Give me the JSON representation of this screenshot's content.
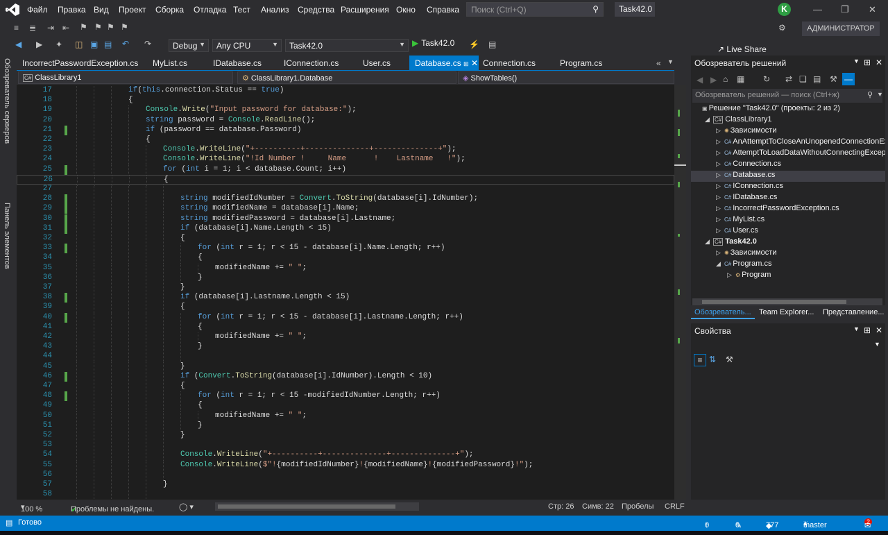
{
  "menu": {
    "items": [
      "Файл",
      "Правка",
      "Вид",
      "Проект",
      "Сборка",
      "Отладка",
      "Тест",
      "Анализ",
      "Средства",
      "Расширения",
      "Окно",
      "Справка"
    ],
    "search_placeholder": "Поиск (Ctrl+Q)",
    "solution_title": "Task42.0",
    "avatar_letter": "K"
  },
  "toolbar": {
    "config": "Debug",
    "platform": "Any CPU",
    "startup_project": "Task42.0",
    "run_label": "Task42.0",
    "live_share": "Live Share",
    "admin_label": "АДМИНИСТРАТОР"
  },
  "side_tabs": [
    "Обозреватель серверов",
    "Панель элементов"
  ],
  "doc_tabs": [
    {
      "label": "IncorrectPasswordException.cs"
    },
    {
      "label": "MyList.cs"
    },
    {
      "label": "IDatabase.cs"
    },
    {
      "label": "IConnection.cs"
    },
    {
      "label": "User.cs"
    },
    {
      "label": "Database.cs",
      "active": true
    },
    {
      "label": "Connection.cs"
    },
    {
      "label": "Program.cs"
    }
  ],
  "nav": {
    "project": "ClassLibrary1",
    "type": "ClassLibrary1.Database",
    "member": "ShowTables()"
  },
  "code_lines": [
    {
      "n": "17",
      "indent": 3,
      "changed": false,
      "t": [
        [
          "kw",
          "if"
        ],
        [
          "",
          "("
        ],
        [
          "kw",
          "this"
        ],
        [
          "",
          ".connection.Status == "
        ],
        [
          "kw",
          "true"
        ],
        [
          "",
          ")"
        ]
      ]
    },
    {
      "n": "18",
      "indent": 3,
      "changed": false,
      "t": [
        [
          "",
          "{"
        ]
      ]
    },
    {
      "n": "19",
      "indent": 4,
      "changed": false,
      "t": [
        [
          "ty",
          "Console"
        ],
        [
          "",
          "."
        ],
        [
          "me",
          "Write"
        ],
        [
          "",
          "("
        ],
        [
          "st",
          "\"Input password for database:\""
        ],
        [
          "",
          ");"
        ]
      ]
    },
    {
      "n": "20",
      "indent": 4,
      "changed": false,
      "t": [
        [
          "kw",
          "string"
        ],
        [
          "",
          " password = "
        ],
        [
          "ty",
          "Console"
        ],
        [
          "",
          "."
        ],
        [
          "me",
          "ReadLine"
        ],
        [
          "",
          "();"
        ]
      ]
    },
    {
      "n": "21",
      "indent": 4,
      "changed": true,
      "t": [
        [
          "kw",
          "if"
        ],
        [
          "",
          " (password == database.Password)"
        ]
      ]
    },
    {
      "n": "22",
      "indent": 4,
      "changed": false,
      "t": [
        [
          "",
          "{"
        ]
      ]
    },
    {
      "n": "23",
      "indent": 5,
      "changed": false,
      "t": [
        [
          "ty",
          "Console"
        ],
        [
          "",
          "."
        ],
        [
          "me",
          "WriteLine"
        ],
        [
          "",
          "("
        ],
        [
          "st",
          "\"+----------+--------------+--------------+\""
        ],
        [
          "",
          ");"
        ]
      ]
    },
    {
      "n": "24",
      "indent": 5,
      "changed": false,
      "t": [
        [
          "ty",
          "Console"
        ],
        [
          "",
          "."
        ],
        [
          "me",
          "WriteLine"
        ],
        [
          "",
          "("
        ],
        [
          "st",
          "\"!Id Number !     Name      !    Lastname   !\""
        ],
        [
          "",
          ");"
        ]
      ]
    },
    {
      "n": "25",
      "indent": 5,
      "changed": true,
      "t": [
        [
          "kw",
          "for"
        ],
        [
          "",
          " ("
        ],
        [
          "kw",
          "int"
        ],
        [
          "",
          " i = 1; i < database.Count; i++)"
        ]
      ]
    },
    {
      "n": "26",
      "indent": 5,
      "changed": false,
      "current": true,
      "t": [
        [
          "",
          "{"
        ]
      ]
    },
    {
      "n": "27",
      "indent": 6,
      "changed": false,
      "t": []
    },
    {
      "n": "28",
      "indent": 6,
      "changed": true,
      "t": [
        [
          "kw",
          "string"
        ],
        [
          "",
          " modifiedIdNumber = "
        ],
        [
          "ty",
          "Convert"
        ],
        [
          "",
          "."
        ],
        [
          "me",
          "ToString"
        ],
        [
          "",
          "(database[i].IdNumber);"
        ]
      ]
    },
    {
      "n": "29",
      "indent": 6,
      "changed": true,
      "t": [
        [
          "kw",
          "string"
        ],
        [
          "",
          " modifiedName = database[i].Name;"
        ]
      ]
    },
    {
      "n": "30",
      "indent": 6,
      "changed": true,
      "t": [
        [
          "kw",
          "string"
        ],
        [
          "",
          " modifiedPassword = database[i].Lastname;"
        ]
      ]
    },
    {
      "n": "31",
      "indent": 6,
      "changed": true,
      "t": [
        [
          "kw",
          "if"
        ],
        [
          "",
          " (database[i].Name.Length < 15)"
        ]
      ]
    },
    {
      "n": "32",
      "indent": 6,
      "changed": false,
      "t": [
        [
          "",
          "{"
        ]
      ]
    },
    {
      "n": "33",
      "indent": 7,
      "changed": true,
      "t": [
        [
          "kw",
          "for"
        ],
        [
          "",
          " ("
        ],
        [
          "kw",
          "int"
        ],
        [
          "",
          " r = 1; r < 15 - database[i].Name.Length; r++)"
        ]
      ]
    },
    {
      "n": "34",
      "indent": 7,
      "changed": false,
      "t": [
        [
          "",
          "{"
        ]
      ]
    },
    {
      "n": "35",
      "indent": 8,
      "changed": false,
      "t": [
        [
          "",
          "modifiedName += "
        ],
        [
          "st",
          "\" \""
        ],
        [
          "",
          ";"
        ]
      ]
    },
    {
      "n": "36",
      "indent": 7,
      "changed": false,
      "t": [
        [
          "",
          "}"
        ]
      ]
    },
    {
      "n": "37",
      "indent": 6,
      "changed": false,
      "t": [
        [
          "",
          "}"
        ]
      ]
    },
    {
      "n": "38",
      "indent": 6,
      "changed": true,
      "t": [
        [
          "kw",
          "if"
        ],
        [
          "",
          " (database[i].Lastname.Length < 15)"
        ]
      ]
    },
    {
      "n": "39",
      "indent": 6,
      "changed": false,
      "t": [
        [
          "",
          "{"
        ]
      ]
    },
    {
      "n": "40",
      "indent": 7,
      "changed": true,
      "t": [
        [
          "kw",
          "for"
        ],
        [
          "",
          " ("
        ],
        [
          "kw",
          "int"
        ],
        [
          "",
          " r = 1; r < 15 - database[i].Lastname.Length; r++)"
        ]
      ]
    },
    {
      "n": "41",
      "indent": 7,
      "changed": false,
      "t": [
        [
          "",
          "{"
        ]
      ]
    },
    {
      "n": "42",
      "indent": 8,
      "changed": false,
      "t": [
        [
          "",
          "modifiedName += "
        ],
        [
          "st",
          "\" \""
        ],
        [
          "",
          ";"
        ]
      ]
    },
    {
      "n": "43",
      "indent": 7,
      "changed": false,
      "t": [
        [
          "",
          "}"
        ]
      ]
    },
    {
      "n": "44",
      "indent": 7,
      "changed": false,
      "t": []
    },
    {
      "n": "45",
      "indent": 6,
      "changed": false,
      "t": [
        [
          "",
          "}"
        ]
      ]
    },
    {
      "n": "46",
      "indent": 6,
      "changed": true,
      "t": [
        [
          "kw",
          "if"
        ],
        [
          "",
          " ("
        ],
        [
          "ty",
          "Convert"
        ],
        [
          "",
          "."
        ],
        [
          "me",
          "ToString"
        ],
        [
          "",
          "(database[i].IdNumber).Length < 10)"
        ]
      ]
    },
    {
      "n": "47",
      "indent": 6,
      "changed": false,
      "t": [
        [
          "",
          "{"
        ]
      ]
    },
    {
      "n": "48",
      "indent": 7,
      "changed": true,
      "t": [
        [
          "kw",
          "for"
        ],
        [
          "",
          " ("
        ],
        [
          "kw",
          "int"
        ],
        [
          "",
          " r = 1; r < 15 -modifiedIdNumber.Length; r++)"
        ]
      ]
    },
    {
      "n": "49",
      "indent": 7,
      "changed": false,
      "t": [
        [
          "",
          "{"
        ]
      ]
    },
    {
      "n": "50",
      "indent": 8,
      "changed": false,
      "t": [
        [
          "",
          "modifiedName += "
        ],
        [
          "st",
          "\" \""
        ],
        [
          "",
          ";"
        ]
      ]
    },
    {
      "n": "51",
      "indent": 7,
      "changed": false,
      "t": [
        [
          "",
          "}"
        ]
      ]
    },
    {
      "n": "52",
      "indent": 6,
      "changed": false,
      "t": [
        [
          "",
          "}"
        ]
      ]
    },
    {
      "n": "53",
      "indent": 6,
      "changed": false,
      "t": []
    },
    {
      "n": "54",
      "indent": 6,
      "changed": false,
      "t": [
        [
          "ty",
          "Console"
        ],
        [
          "",
          "."
        ],
        [
          "me",
          "WriteLine"
        ],
        [
          "",
          "("
        ],
        [
          "st",
          "\"+----------+--------------+--------------+\""
        ],
        [
          "",
          ");"
        ]
      ]
    },
    {
      "n": "55",
      "indent": 6,
      "changed": false,
      "t": [
        [
          "ty",
          "Console"
        ],
        [
          "",
          "."
        ],
        [
          "me",
          "WriteLine"
        ],
        [
          "",
          "("
        ],
        [
          "st",
          "$\"!"
        ],
        [
          "",
          "{modifiedIdNumber}"
        ],
        [
          "st",
          "!"
        ],
        [
          "",
          "{modifiedName}"
        ],
        [
          "st",
          "!"
        ],
        [
          "",
          "{modifiedPassword}"
        ],
        [
          "st",
          "!\""
        ],
        [
          "",
          ");"
        ]
      ]
    },
    {
      "n": "56",
      "indent": 6,
      "changed": false,
      "t": []
    },
    {
      "n": "57",
      "indent": 5,
      "changed": false,
      "t": [
        [
          "",
          "}"
        ]
      ]
    },
    {
      "n": "58",
      "indent": 5,
      "changed": false,
      "t": []
    }
  ],
  "editor_status": {
    "zoom": "100 %",
    "problems": "Проблемы не найдены.",
    "line": "Стр: 26",
    "col": "Симв: 22",
    "spaces": "Пробелы",
    "eol": "CRLF"
  },
  "solution_explorer": {
    "title": "Обозреватель решений",
    "search_placeholder": "Обозреватель решений — поиск (Ctrl+ж)",
    "tree": [
      {
        "level": 0,
        "expander": "",
        "icon": "solution",
        "label": "Решение \"Task42.0\" (проекты: 2 из 2)"
      },
      {
        "level": 1,
        "expander": "◢",
        "icon": "project",
        "label": "ClassLibrary1"
      },
      {
        "level": 2,
        "expander": "▷",
        "icon": "deps",
        "label": "Зависимости"
      },
      {
        "level": 2,
        "expander": "▷",
        "icon": "cs",
        "label": "AnAttemptToCloseAnUnopenedConnectionEx"
      },
      {
        "level": 2,
        "expander": "▷",
        "icon": "cs",
        "label": "AttemptToLoadDataWithoutConnectingExcep"
      },
      {
        "level": 2,
        "expander": "▷",
        "icon": "cs",
        "label": "Connection.cs"
      },
      {
        "level": 2,
        "expander": "▷",
        "icon": "cs",
        "label": "Database.cs",
        "selected": true
      },
      {
        "level": 2,
        "expander": "▷",
        "icon": "cs",
        "label": "IConnection.cs"
      },
      {
        "level": 2,
        "expander": "▷",
        "icon": "cs",
        "label": "IDatabase.cs"
      },
      {
        "level": 2,
        "expander": "▷",
        "icon": "cs",
        "label": "IncorrectPasswordException.cs"
      },
      {
        "level": 2,
        "expander": "▷",
        "icon": "cs",
        "label": "MyList.cs"
      },
      {
        "level": 2,
        "expander": "▷",
        "icon": "cs",
        "label": "User.cs"
      },
      {
        "level": 1,
        "expander": "◢",
        "icon": "project",
        "label": "Task42.0",
        "bold": true
      },
      {
        "level": 2,
        "expander": "▷",
        "icon": "deps",
        "label": "Зависимости"
      },
      {
        "level": 2,
        "expander": "◢",
        "icon": "cs",
        "label": "Program.cs"
      },
      {
        "level": 3,
        "expander": "▷",
        "icon": "class",
        "label": "Program"
      }
    ],
    "tabs": [
      "Обозреватель...",
      "Team Explorer...",
      "Представление..."
    ]
  },
  "properties": {
    "title": "Свойства"
  },
  "statusbar": {
    "ready": "Готово",
    "up": "0",
    "pencil": "0",
    "commits": "777",
    "branch": "master",
    "notifications": "2"
  }
}
